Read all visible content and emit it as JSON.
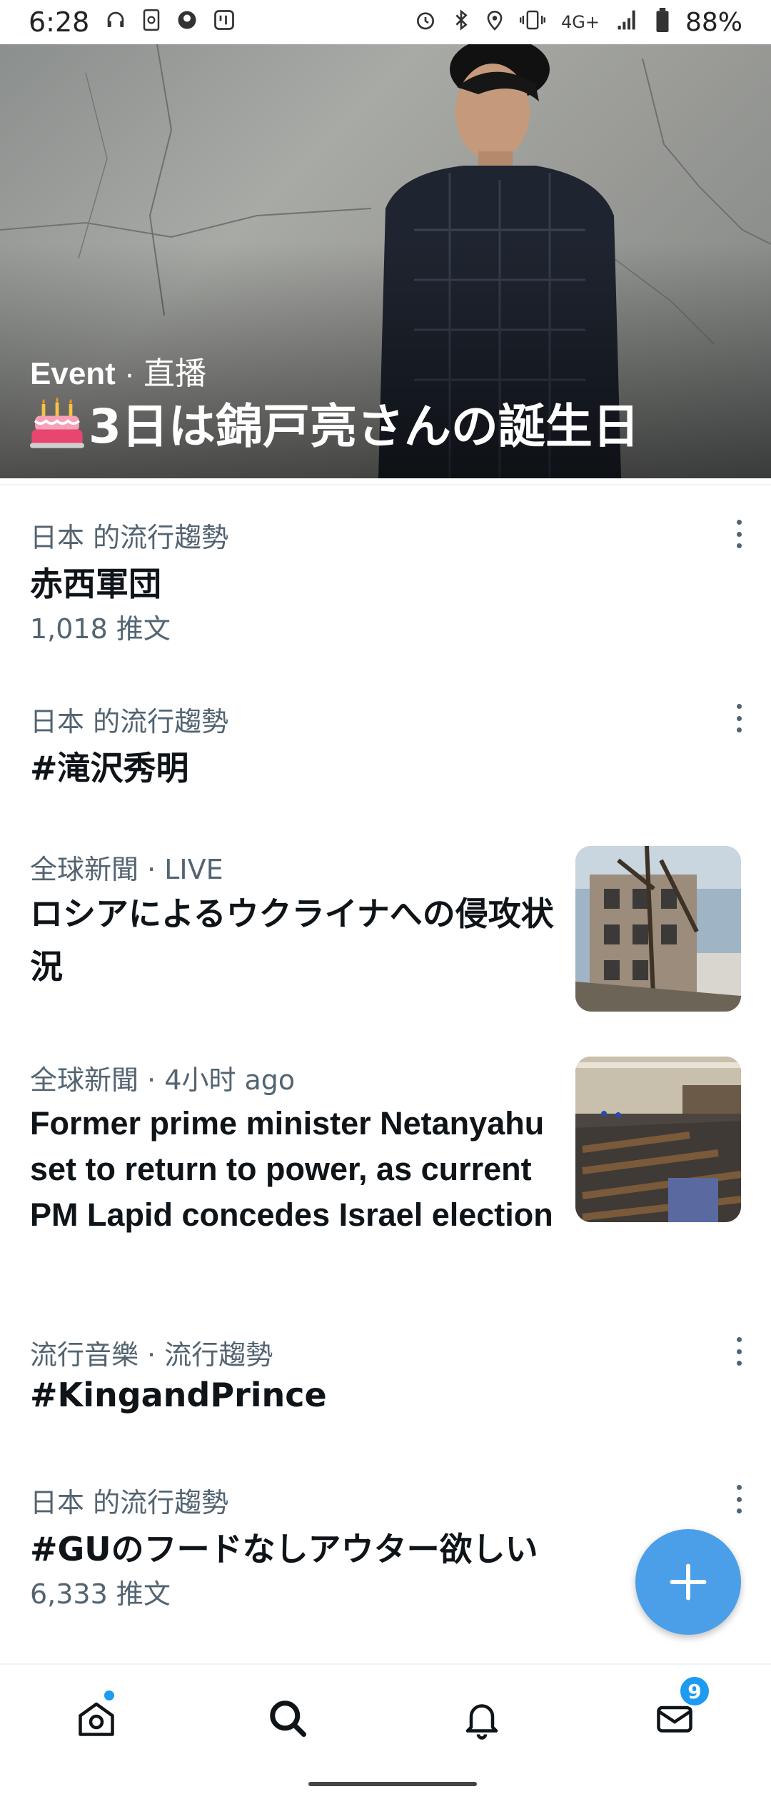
{
  "status_bar": {
    "time": "6:28",
    "network": "4G+",
    "battery": "88%"
  },
  "hero": {
    "category": "Event",
    "separator": "·",
    "live_label": "直播",
    "title": "3日は錦戸亮さんの誕生日"
  },
  "trends": [
    {
      "meta": "日本 的流行趨勢",
      "title": "赤西軍団",
      "count": "1,018 推文"
    },
    {
      "meta": "日本 的流行趨勢",
      "title": "#滝沢秀明"
    },
    {
      "meta": "全球新聞 · LIVE",
      "title": "ロシアによるウクライナへの侵攻状況",
      "image_icon": "building-photo"
    },
    {
      "meta": "全球新聞 · 4小时 ago",
      "title": "Former prime minister Netanyahu set to return to power, as current PM Lapid concedes Israel election",
      "image_icon": "parliament-photo"
    },
    {
      "meta": "流行音樂 · 流行趨勢",
      "title": "#KingandPrince"
    },
    {
      "meta": "日本 的流行趨勢",
      "title": "#GUのフードなしアウター欲しい",
      "count": "6,333 推文"
    }
  ],
  "fab": {
    "icon": "plus-icon"
  },
  "nav": {
    "messages_badge": "9",
    "icons": [
      "home-icon",
      "search-icon",
      "bell-icon",
      "mail-icon"
    ]
  },
  "colors": {
    "accent": "#1d9bf0",
    "fab": "#4a9fe8",
    "secondary_text": "#536471",
    "primary_text": "#0f1419"
  }
}
